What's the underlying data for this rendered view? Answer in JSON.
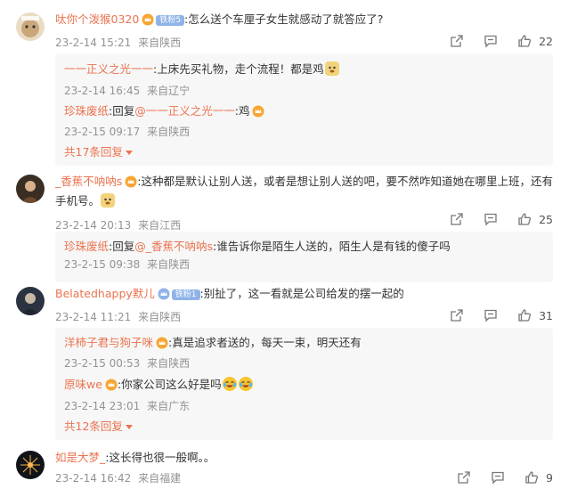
{
  "comments": [
    {
      "user": "呔你个泼猴0320",
      "badge": "铁粉5",
      "text": ":怎么送个车厘子女生就感动了就答应了?",
      "time": "23-2-14 15:21",
      "from": "来自陕西",
      "likes": "22",
      "replies": [
        {
          "user": "一一正义之光一一",
          "text": ":上床先买礼物，走个流程！都是鸡",
          "time": "23-2-14 16:45",
          "from": "来自辽宁"
        },
        {
          "user": "珍珠废纸",
          "reply_word": ":回复",
          "mention": "@一一正义之光一一",
          "text": ":鸡",
          "time": "23-2-15 09:17",
          "from": "来自陕西"
        }
      ],
      "more": "共17条回复"
    },
    {
      "user": "_香蕉不呐呐s",
      "text": ":这种都是默认让别人送，或者是想让别人送的吧，要不然咋知道她在哪里上班，还有手机号。",
      "time": "23-2-14 20:13",
      "from": "来自江西",
      "likes": "25",
      "replies": [
        {
          "user": "珍珠废纸",
          "reply_word": ":回复",
          "mention": "@_香蕉不呐呐s",
          "text": ":谁告诉你是陌生人送的，陌生人是有钱的傻子吗",
          "time": "23-2-15 09:38",
          "from": "来自陕西"
        }
      ]
    },
    {
      "user": "Belatedhappy默儿",
      "badge": "铁粉1",
      "text": ":别扯了，这一看就是公司给发的摆一起的",
      "time": "23-2-14 11:21",
      "from": "来自陕西",
      "likes": "31",
      "replies": [
        {
          "user": "洋柿子君与狗子咪",
          "text": ":真是追求者送的，每天一束，明天还有",
          "time": "23-2-15 00:53",
          "from": "来自陕西"
        },
        {
          "user": "原味we",
          "text": ":你家公司这么好是吗",
          "time": "23-2-14 23:01",
          "from": "来自广东"
        }
      ],
      "more": "共12条回复"
    },
    {
      "user": "如是大梦_",
      "text": ":这长得也很一般啊。。",
      "time": "23-2-14 16:42",
      "from": "来自福建",
      "likes": "9"
    }
  ],
  "colors": {
    "username": "#eb7350",
    "meta": "#939393",
    "reply_bg": "#f7f7f7"
  },
  "icons": [
    "share-icon",
    "comment-icon",
    "like-icon",
    "vip-crown-icon",
    "doge-emoji",
    "laugh-cry-emoji"
  ]
}
